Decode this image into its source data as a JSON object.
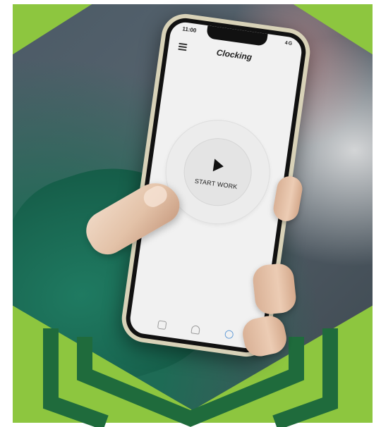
{
  "phone": {
    "status_time": "11:00",
    "status_right": "4G",
    "app_title": "Clocking",
    "start_label": "START WORK"
  },
  "icons": {
    "menu": "menu-icon",
    "play": "play-icon",
    "nav": [
      "calendar-icon",
      "document-icon",
      "profile-icon"
    ]
  },
  "colors": {
    "brand_green": "#8dc63f",
    "dark_green": "#1f6b3c"
  }
}
